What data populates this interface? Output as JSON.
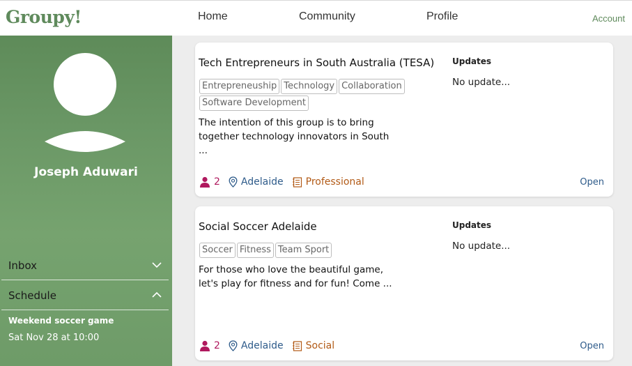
{
  "nav": {
    "logo": "Groupy!",
    "links": [
      "Home",
      "Community",
      "Profile"
    ],
    "account": "Account"
  },
  "sidebar": {
    "user_name": "Joseph Aduwari",
    "inbox_label": "Inbox",
    "schedule_label": "Schedule",
    "schedule_event_title": "Weekend soccer game",
    "schedule_event_time": "Sat Nov 28 at 10:00"
  },
  "groups": [
    {
      "title": "Tech Entrepreneurs in South Australia (TESA)",
      "tags": [
        "Entrepreneuship",
        "Technology",
        "Collaboration",
        "Software Development"
      ],
      "description_line1": "The intention of this group is to bring",
      "description_line2": "together technology innovators in South",
      "description_line3": "...",
      "updates_heading": "Updates",
      "updates_text": "No update...",
      "members": "2",
      "location": "Adelaide",
      "type": "Professional",
      "open_label": "Open"
    },
    {
      "title": "Social Soccer Adelaide",
      "tags": [
        "Soccer",
        "Fitness",
        "Team Sport"
      ],
      "description_line1": "For those who love the beautiful game,",
      "description_line2": "let's play for fitness and for fun! Come ...",
      "description_line3": "",
      "updates_heading": "Updates",
      "updates_text": "No update...",
      "members": "2",
      "location": "Adelaide",
      "type": "Social",
      "open_label": "Open"
    }
  ],
  "colors": {
    "brand_green": "#5f8a5c",
    "members_color": "#b0195e",
    "location_color": "#2e5b8a",
    "type_color": "#b25a16"
  },
  "icons": {
    "members": "person-icon",
    "location": "map-pin-icon",
    "type": "notebook-icon",
    "inbox_toggle": "chevron-down-icon",
    "schedule_toggle": "chevron-up-icon"
  }
}
